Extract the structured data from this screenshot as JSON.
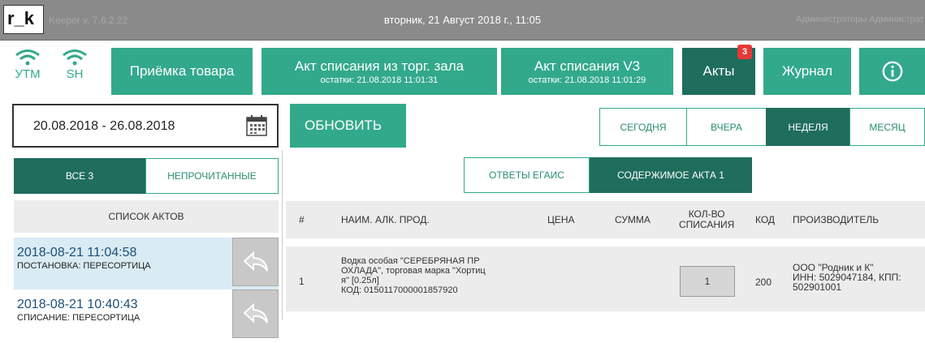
{
  "titlebar": {
    "logo": "r_k",
    "version": "Keeper v. 7.6.2.22",
    "datetime": "вторник, 21 Август 2018 г., 11:05",
    "user": "Администраторы Администрат"
  },
  "nav": {
    "utm_label": "УТМ",
    "sh_label": "SH",
    "receiving": "Приёмка товара",
    "writeoff_hall": "Акт списания из торг. зала",
    "writeoff_hall_sub": "остатки: 21.08.2018 11:01:31",
    "writeoff_v3": "Акт списания V3",
    "writeoff_v3_sub": "остатки: 21.08.2018 11:01:29",
    "acts": "Акты",
    "acts_badge": "3",
    "journal": "Журнал"
  },
  "filters": {
    "date_range": "20.08.2018 - 26.08.2018",
    "refresh": "ОБНОВИТЬ",
    "today": "СЕГОДНЯ",
    "yesterday": "ВЧЕРА",
    "week": "НЕДЕЛЯ",
    "month": "МЕСЯЦ"
  },
  "left": {
    "all": "ВСЕ  3",
    "unread": "НЕПРОЧИТАННЫЕ",
    "list_header": "СПИСОК АКТОВ",
    "items": [
      {
        "datetime": "2018-08-21   11:04:58",
        "status": "ПОСТАНОВКА: ПЕРЕСОРТИЦА"
      },
      {
        "datetime": "2018-08-21   10:40:43",
        "status": "СПИСАНИЕ: ПЕРЕСОРТИЦА"
      }
    ]
  },
  "right": {
    "tab_answers": "ОТВЕТЫ ЕГАИС",
    "tab_content": "СОДЕРЖИМОЕ АКТА  1",
    "columns": {
      "num": "#",
      "name": "НАИМ. АЛК. ПРОД.",
      "price": "ЦЕНА",
      "sum": "СУММА",
      "qty_1": "КОЛ-ВО",
      "qty_2": "СПИСАНИЯ",
      "code": "КОД",
      "producer": "ПРОИЗВОДИТЕЛЬ"
    },
    "row": {
      "num": "1",
      "name_1": "Водка особая \"СЕРЕБРЯНАЯ ПР",
      "name_2": "ОХЛАДА\", торговая марка \"Хортиц",
      "name_3": "я\" [0.25л]",
      "name_4": "КОД: 0150117000001857920",
      "qty": "1",
      "code": "200",
      "producer_1": "ООО \"Родник и К\"",
      "producer_2": "ИНН: 5029047184, КПП:",
      "producer_3": "502901001"
    }
  },
  "colors": {
    "accent": "#32a98b",
    "accent_dark": "#1f6d5c",
    "titlebar": "#8a8a8a",
    "badge": "#e53935"
  }
}
